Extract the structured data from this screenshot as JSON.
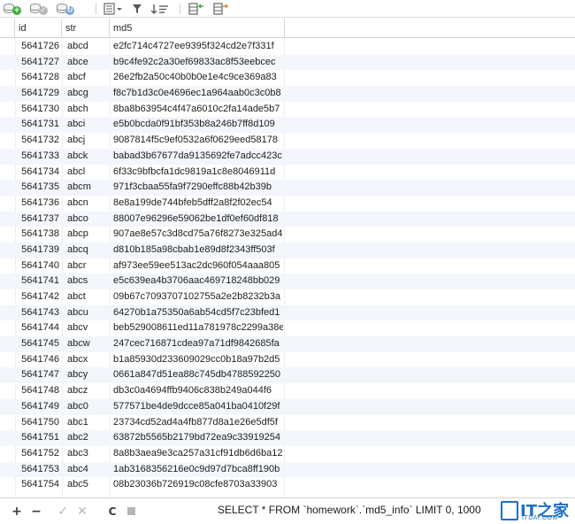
{
  "toolbar": {
    "buttons": [
      "add-record-icon",
      "apply-changes-icon",
      "discard-changes-icon",
      "form-view-icon",
      "filter-icon",
      "sort-icon",
      "import-icon",
      "export-icon"
    ]
  },
  "columns": [
    "id",
    "str",
    "md5"
  ],
  "rows": [
    {
      "id": "5641726",
      "str": "abcd",
      "md5": "e2fc714c4727ee9395f324cd2e7f331f"
    },
    {
      "id": "5641727",
      "str": "abce",
      "md5": "b9c4fe92c2a30ef69833ac8f53eebcec"
    },
    {
      "id": "5641728",
      "str": "abcf",
      "md5": "26e2fb2a50c40b0b0e1e4c9ce369a83"
    },
    {
      "id": "5641729",
      "str": "abcg",
      "md5": "f8c7b1d3c0e4696ec1a964aab0c3c0b8"
    },
    {
      "id": "5641730",
      "str": "abch",
      "md5": "8ba8b63954c4f47a6010c2fa14ade5b7"
    },
    {
      "id": "5641731",
      "str": "abci",
      "md5": "e5b0bcda0f91bf353b8a246b7ff8d109"
    },
    {
      "id": "5641732",
      "str": "abcj",
      "md5": "9087814f5c9ef0532a6f0629eed58178"
    },
    {
      "id": "5641733",
      "str": "abck",
      "md5": "babad3b67677da9135692fe7adcc423c"
    },
    {
      "id": "5641734",
      "str": "abcl",
      "md5": "6f33c9bfbcfa1dc9819a1c8e8046911d"
    },
    {
      "id": "5641735",
      "str": "abcm",
      "md5": "971f3cbaa55fa9f7290effc88b42b39b"
    },
    {
      "id": "5641736",
      "str": "abcn",
      "md5": "8e8a199de744bfeb5dff2a8f2f02ec54"
    },
    {
      "id": "5641737",
      "str": "abco",
      "md5": "88007e96296e59062be1df0ef60df818"
    },
    {
      "id": "5641738",
      "str": "abcp",
      "md5": "907ae8e57c3d8cd75a76f8273e325ad4"
    },
    {
      "id": "5641739",
      "str": "abcq",
      "md5": "d810b185a98cbab1e89d8f2343ff503f"
    },
    {
      "id": "5641740",
      "str": "abcr",
      "md5": "af973ee59ee513ac2dc960f054aaa805"
    },
    {
      "id": "5641741",
      "str": "abcs",
      "md5": "e5c639ea4b3706aac469718248bb029"
    },
    {
      "id": "5641742",
      "str": "abct",
      "md5": "09b67c7093707102755a2e2b8232b3a"
    },
    {
      "id": "5641743",
      "str": "abcu",
      "md5": "64270b1a75350a6ab54cd5f7c23bfed1"
    },
    {
      "id": "5641744",
      "str": "abcv",
      "md5": "beb529008611ed11a781978c2299a38e"
    },
    {
      "id": "5641745",
      "str": "abcw",
      "md5": "247cec716871cdea97a71df9842685fa"
    },
    {
      "id": "5641746",
      "str": "abcx",
      "md5": "b1a85930d233609029cc0b18a97b2d5"
    },
    {
      "id": "5641747",
      "str": "abcy",
      "md5": "0661a847d51ea88c745db4788592250"
    },
    {
      "id": "5641748",
      "str": "abcz",
      "md5": "db3c0a4694ffb9406c838b249a044f6"
    },
    {
      "id": "5641749",
      "str": "abc0",
      "md5": "577571be4de9dcce85a041ba0410f29f"
    },
    {
      "id": "5641750",
      "str": "abc1",
      "md5": "23734cd52ad4a4fb877d8a1e26e5df5f"
    },
    {
      "id": "5641751",
      "str": "abc2",
      "md5": "63872b5565b2179bd72ea9c33919254"
    },
    {
      "id": "5641752",
      "str": "abc3",
      "md5": "8a8b3aea9e3ca257a31cf91db6d6ba12"
    },
    {
      "id": "5641753",
      "str": "abc4",
      "md5": "1ab3168356216e0c9d97d7bca8ff190b"
    },
    {
      "id": "5641754",
      "str": "abc5",
      "md5": "08b23036b726919c08cfe8703a33903"
    }
  ],
  "bottombar": {
    "add": "+",
    "remove": "−",
    "apply": "✓",
    "discard": "✕",
    "refresh": "C",
    "sql": "SELECT * FROM `homework`.`md5_info` LIMIT 0, 1000"
  },
  "watermark": {
    "big": "IT之家",
    "sub": "ITDAI.COM"
  },
  "colors": {
    "accent": "#1e6fc4",
    "row_alt": "#f3f6fa",
    "add_green": "#3fae3f"
  }
}
